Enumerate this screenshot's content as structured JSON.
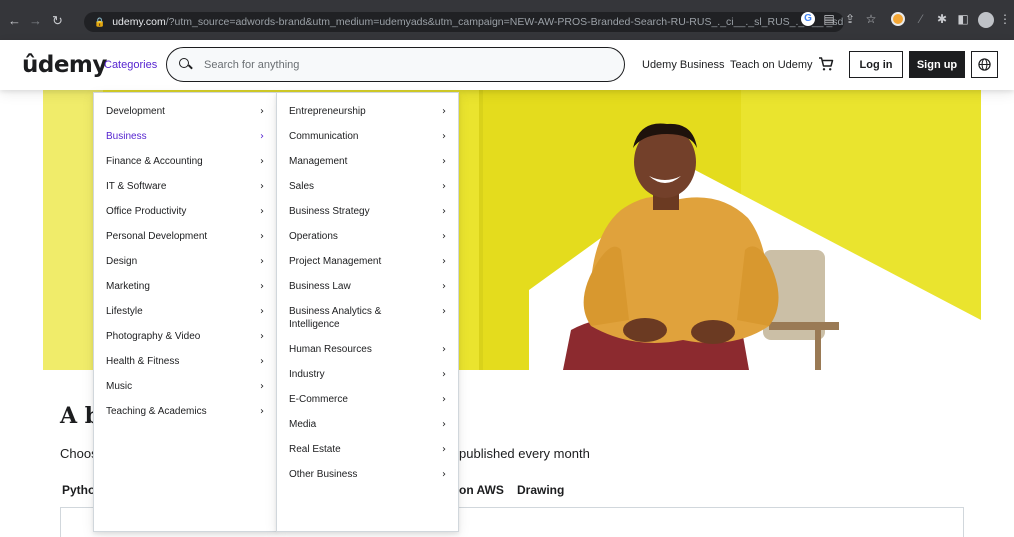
{
  "browser": {
    "url_host": "udemy.com",
    "url_path": "/?utm_source=adwords-brand&utm_medium=udemyads&utm_campaign=NEW-AW-PROS-Branded-Search-RU-RUS_._ci__._sl_RUS_._vi__._sd_All_..."
  },
  "header": {
    "logo": "ûdemy",
    "categories_label": "Categories",
    "search_placeholder": "Search for anything",
    "business_link": "Udemy Business",
    "teach_link": "Teach on Udemy",
    "login_label": "Log in",
    "signup_label": "Sign up"
  },
  "menu": {
    "primary": [
      "Development",
      "Business",
      "Finance & Accounting",
      "IT & Software",
      "Office Productivity",
      "Personal Development",
      "Design",
      "Marketing",
      "Lifestyle",
      "Photography & Video",
      "Health & Fitness",
      "Music",
      "Teaching & Academics"
    ],
    "secondary": [
      "Entrepreneurship",
      "Communication",
      "Management",
      "Sales",
      "Business Strategy",
      "Operations",
      "Project Management",
      "Business Law",
      "Business Analytics & Intelligence",
      "Human Resources",
      "Industry",
      "E-Commerce",
      "Media",
      "Real Estate",
      "Other Business"
    ]
  },
  "main": {
    "headline_fragment": "A b",
    "subtext_fragment": "Choos",
    "subtext_tail": "published every month",
    "tabs": [
      "Pytho",
      "on AWS",
      "Drawing"
    ]
  },
  "colors": {
    "accent": "#5624d0",
    "hero_bg": "#eae42e",
    "dark": "#1c1d1f"
  }
}
